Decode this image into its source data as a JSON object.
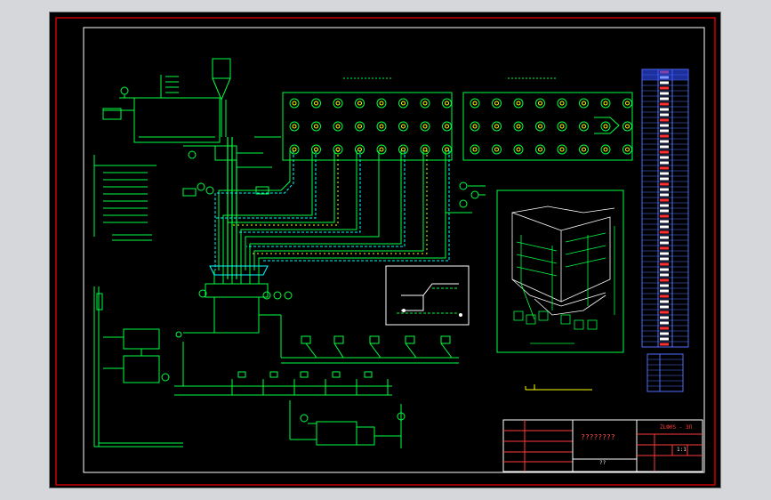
{
  "drawing": {
    "title_block": {
      "drawing_number": "ŻLФ0S - 3Л",
      "drawing_title": "????????",
      "scale": "1:1",
      "subtitle": "??"
    }
  },
  "colors": {
    "background": "#000000",
    "frame": "#cc0000",
    "inner_frame": "#ffffff",
    "piping": "#00ff40",
    "cyan_lines": "#00ffff",
    "yellow_lines": "#ffff00",
    "legend_fill": "#3050ff",
    "legend_grid": "#ffffff"
  }
}
